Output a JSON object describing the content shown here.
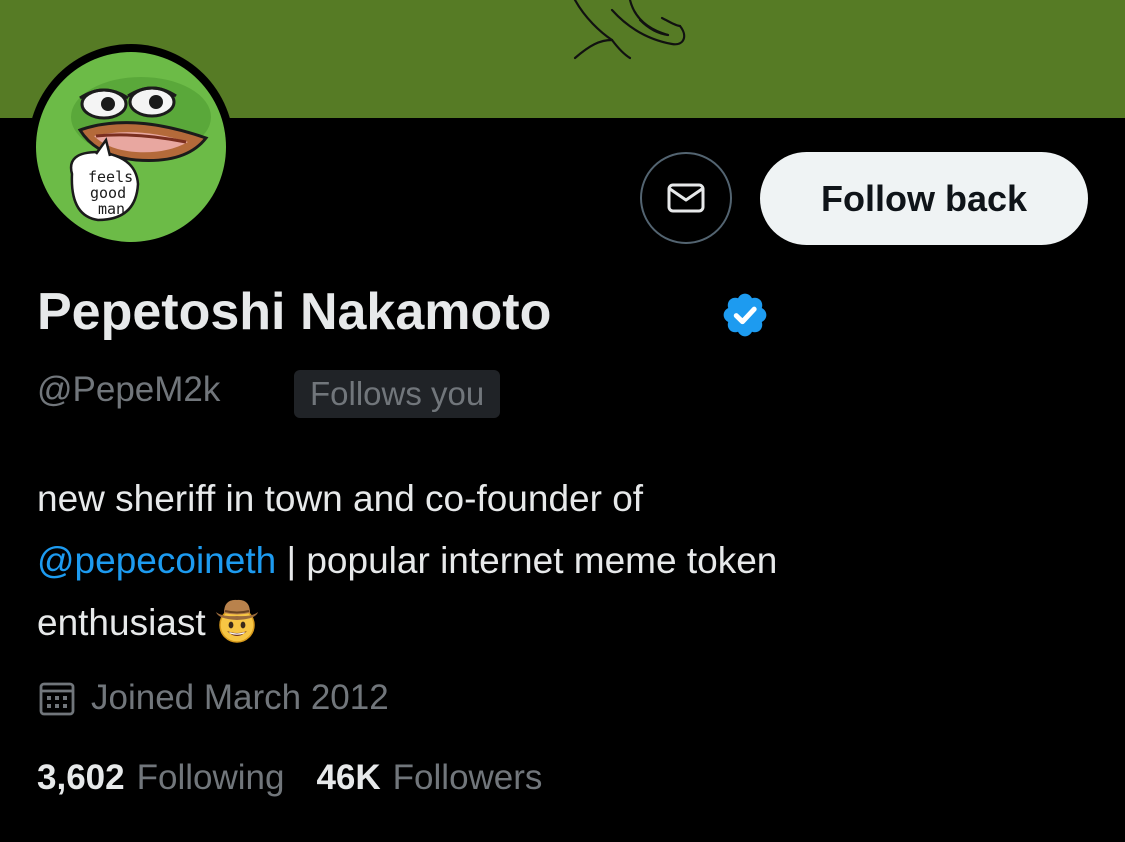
{
  "colors": {
    "background": "#000000",
    "banner": "#567b25",
    "avatar_bg": "#6cbb47",
    "text_primary": "#e7e9ea",
    "text_secondary": "#71767b",
    "link": "#1d9bf0",
    "follow_button_bg": "#eff3f4"
  },
  "avatar": {
    "caption_lines": [
      "feels",
      "good",
      "man"
    ]
  },
  "actions": {
    "message_icon": "envelope-icon",
    "follow_back_label": "Follow back"
  },
  "profile": {
    "display_name": "Pepetoshi Nakamoto",
    "verified_icon": "verified-badge-icon",
    "handle": "@PepeM2k",
    "follows_you": "Follows you",
    "bio": {
      "line1": "new sheriff in town and co-founder of",
      "mention": "@pepecoineth",
      "line2_rest": " | popular internet meme token",
      "line3": "enthusiast",
      "emoji": "cowboy-hat-face-emoji"
    },
    "joined_icon": "calendar-icon",
    "joined": "Joined March 2012"
  },
  "stats": {
    "following_count": "3,602",
    "following_label": "Following",
    "followers_count": "46K",
    "followers_label": "Followers"
  }
}
